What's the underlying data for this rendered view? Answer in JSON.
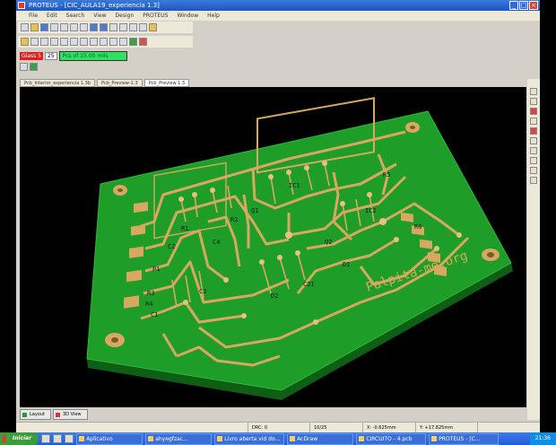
{
  "window": {
    "title": "PROTEUS - [CIC_AULA19_experiencia 1.3]",
    "menu": [
      "File",
      "Edit",
      "Search",
      "View",
      "Design",
      "PROTEUS",
      "Window",
      "Help"
    ]
  },
  "layer_bar": {
    "layer": "Glass 5",
    "number": "25",
    "grid": "Pcs of 25.00 mils"
  },
  "doc_tabs": [
    "Pcb_Interior_experiencia 1.3b",
    "Pcb_Preview-1.3",
    "Pcb_Preview 1.3"
  ],
  "board": {
    "watermark": "Palpita-me.org",
    "labels": [
      "P1",
      "R3",
      "R4",
      "C1",
      "C2",
      "C3",
      "C4",
      "Q1",
      "Q2",
      "IC1",
      "IC2",
      "R1",
      "R2",
      "C21",
      "R5",
      "R6",
      "D1",
      "D2"
    ]
  },
  "bottom_tabs": [
    "Layout",
    "3D View"
  ],
  "status": {
    "snap": "DRC: 0",
    "layer": "10/25",
    "x": "X: -0.625mm",
    "y": "Y: +17.825mm"
  },
  "taskbar": {
    "start": "Iniciar",
    "tasks": [
      "Aplicativo",
      "ahyegfzac...",
      "Livro aberta vid do...",
      "AcDraw",
      "CIRCUITO - 4.pcb",
      "PROTEUS - [C..."
    ],
    "clock": "21:36"
  },
  "colors": {
    "board": "#1e9e28",
    "copper": "#d8a860",
    "title_bar": "#1c56c4"
  }
}
